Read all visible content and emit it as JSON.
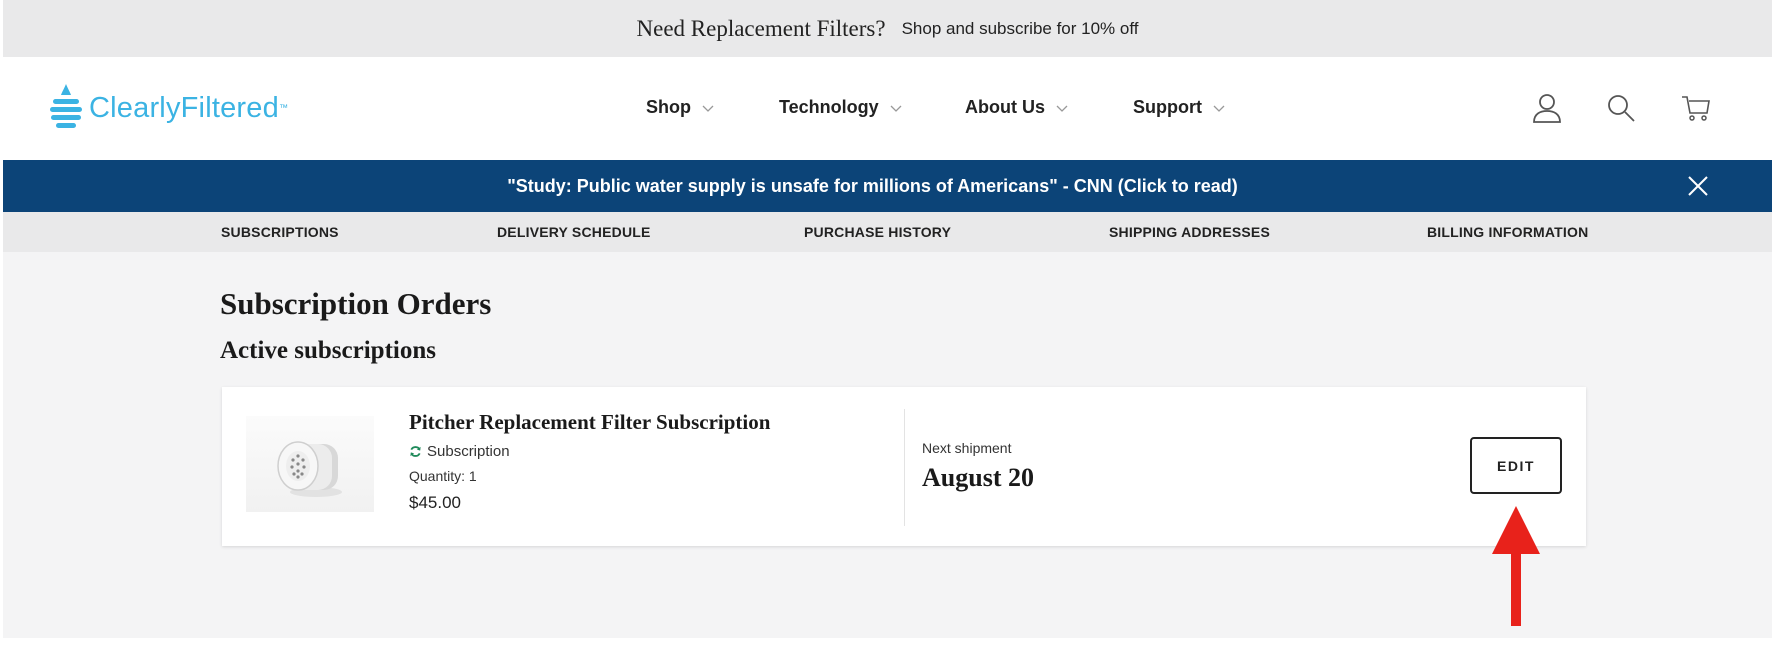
{
  "promo": {
    "title": "Need Replacement Filters?",
    "subtitle": "Shop and subscribe for 10% off"
  },
  "header": {
    "logo": "ClearlyFiltered",
    "logo_tm": "™",
    "nav": [
      "Shop",
      "Technology",
      "About Us",
      "Support"
    ],
    "icons": [
      "account-icon",
      "search-icon",
      "cart-icon"
    ]
  },
  "news": {
    "text": "\"Study: Public water supply is unsafe for millions of Americans\" - CNN (Click to read)"
  },
  "account_nav": [
    "SUBSCRIPTIONS",
    "DELIVERY SCHEDULE",
    "PURCHASE HISTORY",
    "SHIPPING ADDRESSES",
    "BILLING INFORMATION"
  ],
  "page": {
    "title": "Subscription Orders",
    "section": "Active subscriptions"
  },
  "subscription": {
    "product": "Pitcher Replacement Filter Subscription",
    "type": "Subscription",
    "quantity": "Quantity: 1",
    "price": "$45.00",
    "next_label": "Next shipment",
    "next_date": "August 20",
    "edit_label": "EDIT"
  },
  "colors": {
    "brand": "#3bb3e3",
    "news_bar": "#0c4478",
    "arrow": "#e8221b",
    "subscription_icon": "#1f8a5a"
  }
}
